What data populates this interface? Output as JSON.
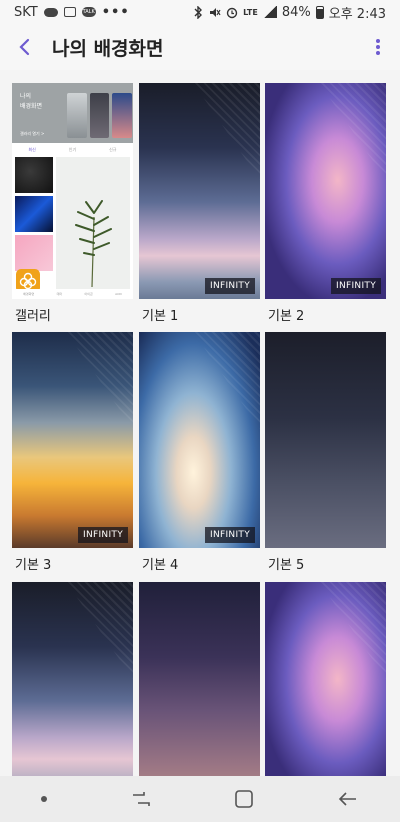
{
  "status_bar": {
    "carrier": "SKT",
    "lte": "LTE",
    "battery_percent": "84%",
    "time": "오후 2:43",
    "talk_label": "TALK",
    "dots": "•••"
  },
  "app_bar": {
    "title": "나의 배경화면"
  },
  "gallery": {
    "label": "갤러리",
    "preview_title_1": "나의",
    "preview_title_2": "배경화면",
    "preview_link": "갤러리 열기 >",
    "tabs": [
      "최신",
      "인기",
      "신규"
    ],
    "bottom_tabs": [
      "배경화면",
      "테마",
      "아이콘",
      "AOD"
    ]
  },
  "wallpapers": [
    {
      "label": "기본 1",
      "badge": "INFINITY"
    },
    {
      "label": "기본 2",
      "badge": "INFINITY"
    },
    {
      "label": "기본 3",
      "badge": "INFINITY"
    },
    {
      "label": "기본 4",
      "badge": "INFINITY"
    },
    {
      "label": "기본 5",
      "badge": ""
    },
    {
      "label": "",
      "badge": ""
    },
    {
      "label": "",
      "badge": ""
    },
    {
      "label": "",
      "badge": ""
    }
  ],
  "colors": {
    "accent": "#6e5bd0"
  }
}
